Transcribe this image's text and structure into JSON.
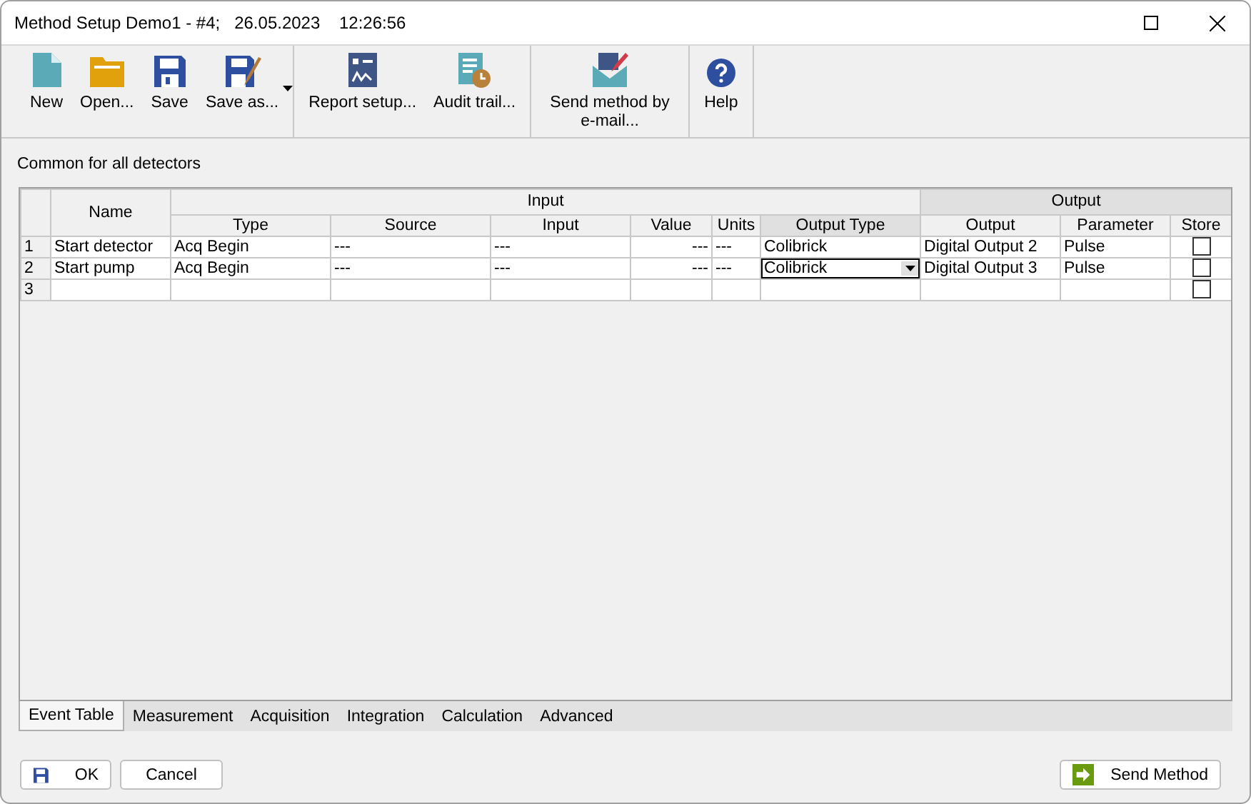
{
  "window": {
    "title": "Method Setup Demo1 - #4;   26.05.2023    12:26:56"
  },
  "toolbar": [
    [
      {
        "kind": "new",
        "label": "New"
      },
      {
        "kind": "open",
        "label": "Open..."
      },
      {
        "kind": "save",
        "label": "Save"
      },
      {
        "kind": "save_as",
        "label": "Save as...",
        "has_menu": true
      }
    ],
    [
      {
        "kind": "report",
        "label": "Report setup..."
      },
      {
        "kind": "audit",
        "label": "Audit trail..."
      }
    ],
    [
      {
        "kind": "email",
        "label": "Send method by e-mail..."
      }
    ],
    [
      {
        "kind": "help",
        "label": "Help"
      }
    ]
  ],
  "section_label": "Common for all detectors",
  "table": {
    "groups": [
      {
        "label": "Input"
      },
      {
        "label": "Output"
      }
    ],
    "name_column": "Name",
    "columns": [
      "Type",
      "Source",
      "Input",
      "Value",
      "Units",
      "Output Type",
      "Output",
      "Parameter",
      "Store"
    ],
    "rows": [
      {
        "number": "1",
        "name": "Start detector",
        "type": "Acq Begin",
        "source": "---",
        "input": "---",
        "value": "---",
        "units": "---",
        "output_type": "Colibrick",
        "output": "Digital Output 2",
        "parameter": "Pulse",
        "store": false,
        "editing": false
      },
      {
        "number": "2",
        "name": "Start pump",
        "type": "Acq Begin",
        "source": "---",
        "input": "---",
        "value": "---",
        "units": "---",
        "output_type": "Colibrick",
        "output": "Digital Output 3",
        "parameter": "Pulse",
        "store": false,
        "editing": true
      },
      {
        "number": "3",
        "store": false,
        "editing": false
      }
    ]
  },
  "tabs": [
    {
      "label": "Event Table",
      "selected": true
    },
    {
      "label": "Measurement",
      "selected": false
    },
    {
      "label": "Acquisition",
      "selected": false
    },
    {
      "label": "Integration",
      "selected": false
    },
    {
      "label": "Calculation",
      "selected": false
    },
    {
      "label": "Advanced",
      "selected": false
    }
  ],
  "buttons_left": [
    {
      "kind": "ok",
      "label": "OK"
    },
    {
      "kind": "cancel",
      "label": "Cancel"
    }
  ],
  "buttons_right": [
    {
      "kind": "send",
      "label": "Send Method"
    }
  ]
}
